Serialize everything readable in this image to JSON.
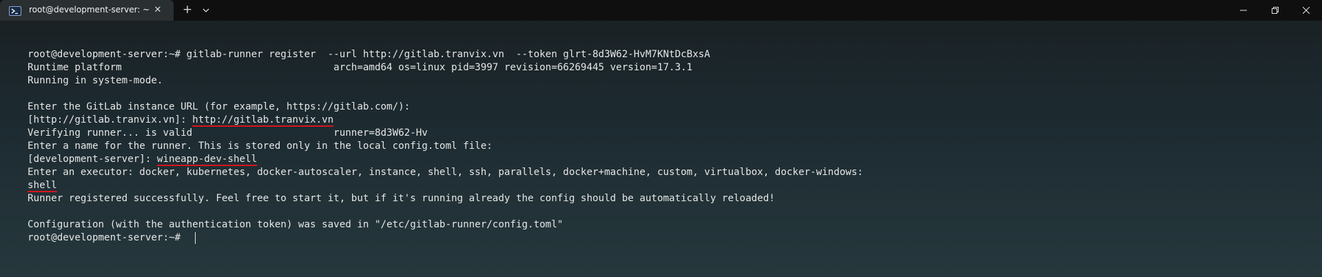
{
  "window": {
    "tab_title": "root@development-server: ~",
    "tab_icon": "powershell-icon",
    "close_tab_symbol": "✕",
    "new_tab_symbol": "+",
    "dropdown_icon": "chevron-down-icon",
    "controls": [
      "minimize-icon",
      "maximize-icon",
      "close-icon"
    ]
  },
  "terminal": {
    "lines": {
      "l1_prompt": "root@development-server:~# ",
      "l1_cmd": "gitlab-runner register  --url http://gitlab.tranvix.vn  --token glrt-8d3W62-HvM7KNtDcBxsA",
      "l2": "Runtime platform                                    arch=amd64 os=linux pid=3997 revision=66269445 version=17.3.1",
      "l3": "Running in system-mode.",
      "l5": "Enter the GitLab instance URL (for example, https://gitlab.com/):",
      "l6_prefix": "[http://gitlab.tranvix.vn]: ",
      "l6_value": "http://gitlab.tranvix.vn",
      "l7": "Verifying runner... is valid                        runner=8d3W62-Hv",
      "l8": "Enter a name for the runner. This is stored only in the local config.toml file:",
      "l9_prefix": "[development-server]: ",
      "l9_value": "wineapp-dev-shell",
      "l10": "Enter an executor: docker, kubernetes, docker-autoscaler, instance, shell, ssh, parallels, docker+machine, custom, virtualbox, docker-windows:",
      "l11_value": "shell",
      "l12": "Runner registered successfully. Feel free to start it, but if it's running already the config should be automatically reloaded!",
      "l14": "Configuration (with the authentication token) was saved in \"/etc/gitlab-runner/config.toml\"",
      "l15_prompt": "root@development-server:~# "
    }
  },
  "colors": {
    "background": "#1e2a30",
    "text": "#e6e6e6",
    "underline": "#d8141e"
  }
}
